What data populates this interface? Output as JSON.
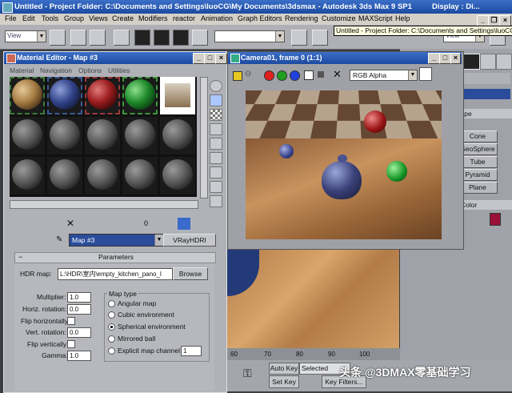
{
  "window": {
    "title": "Untitled   - Project Folder: C:\\Documents and Settings\\luoCG\\My Documents\\3dsmax   - Autodesk 3ds Max 9 SP1   Untitled   - Project Folder: C:\\Documents and Settings\\luoC",
    "title_short": "Untitled   - Project Folder: C:\\Documents and Settings\\luoCG\\My Documents\\3dsmax   - Autodesk 3ds Max 9 SP1",
    "title_tail": "Display : Di..."
  },
  "menubar": [
    "File",
    "Edit",
    "Tools",
    "Group",
    "Views",
    "Create",
    "Modifiers",
    "reactor",
    "Animation",
    "Graph Editors",
    "Rendering",
    "Customize",
    "MAXScript",
    "Help"
  ],
  "toolbar": {
    "view_combo": "View",
    "tooltip": "Untitled   - Project Folder: C:\\Documents and Settings\\luoCG",
    "right_combo": "View"
  },
  "material_editor": {
    "title": "Material Editor - Map #3",
    "menu": [
      "Material",
      "Navigation",
      "Options",
      "Utilities"
    ],
    "map_name": "Map #3",
    "map_type_button": "VRayHDRI",
    "rollout_title": "Parameters",
    "hdr_map_label": "HDR map:",
    "hdr_map_path": "L:\\HDR\\室内\\empty_kitchen_pano_l",
    "browse_label": "Browse",
    "multiplier_label": "Multiplier:",
    "multiplier_value": "1.0",
    "horiz_rot_label": "Horiz. rotation:",
    "horiz_rot_value": "0.0",
    "flip_h_label": "Flip horizontally",
    "vert_rot_label": "Vert. rotation:",
    "vert_rot_value": "0.0",
    "flip_v_label": "Flip vertically",
    "gamma_label": "Gamma:",
    "gamma_value": "1.0",
    "map_type_label": "Map type",
    "map_types": [
      "Angular map",
      "Cubic environment",
      "Spherical environment",
      "Mirrored ball",
      "Explicit map channel"
    ],
    "selected_map_type": "Spherical environment",
    "map_channel_value": "1",
    "zero_value": "0"
  },
  "render_window": {
    "title": "Camera01, frame 0 (1:1)",
    "channel_combo": "RGB Alpha"
  },
  "command_panel": {
    "type_label": "ype",
    "buttons": [
      "Cone",
      "GeoSphere",
      "Tube",
      "Pyramid",
      "Plane"
    ],
    "color_label": "Color"
  },
  "timeline": {
    "ticks": [
      "60",
      "70",
      "80",
      "90",
      "100"
    ]
  },
  "bottom": {
    "auto_key": "Auto Key",
    "selected": "Selected",
    "set_key": "Set Key",
    "key_filters": "Key Filters...",
    "watermark": "头条 @3DMAX零基础学习"
  }
}
